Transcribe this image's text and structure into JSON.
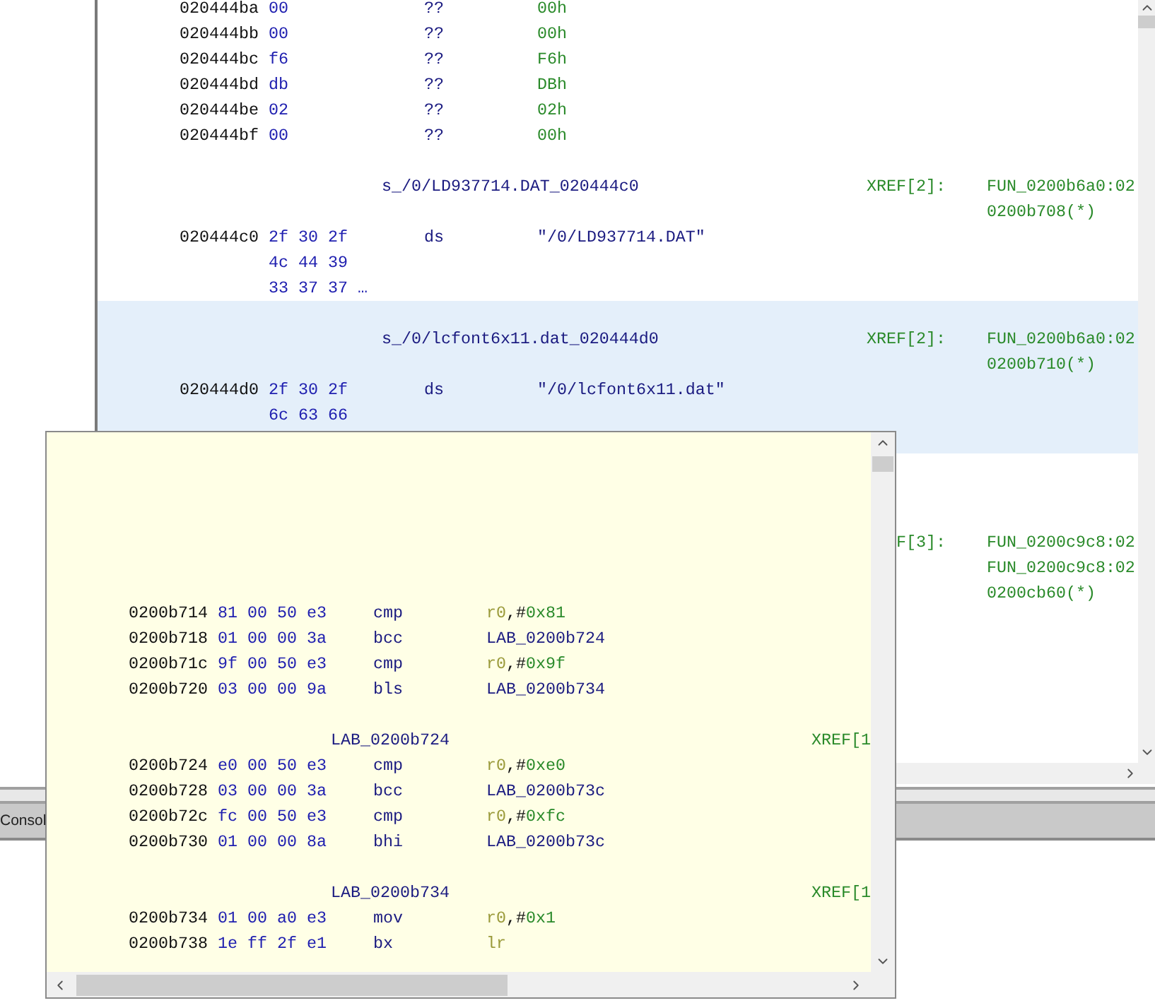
{
  "listing": {
    "rows": [
      {
        "kind": "data",
        "address": "020444ba",
        "bytes": "00",
        "mnemonic": "??",
        "operand": [
          {
            "kind": "scalar",
            "text": "00h"
          }
        ],
        "highlighted": false
      },
      {
        "kind": "data",
        "address": "020444bb",
        "bytes": "00",
        "mnemonic": "??",
        "operand": [
          {
            "kind": "scalar",
            "text": "00h"
          }
        ],
        "highlighted": false
      },
      {
        "kind": "data",
        "address": "020444bc",
        "bytes": "f6",
        "mnemonic": "??",
        "operand": [
          {
            "kind": "scalar",
            "text": "F6h"
          }
        ],
        "highlighted": false
      },
      {
        "kind": "data",
        "address": "020444bd",
        "bytes": "db",
        "mnemonic": "??",
        "operand": [
          {
            "kind": "scalar",
            "text": "DBh"
          }
        ],
        "highlighted": false
      },
      {
        "kind": "data",
        "address": "020444be",
        "bytes": "02",
        "mnemonic": "??",
        "operand": [
          {
            "kind": "scalar",
            "text": "02h"
          }
        ],
        "highlighted": false
      },
      {
        "kind": "data",
        "address": "020444bf",
        "bytes": "00",
        "mnemonic": "??",
        "operand": [
          {
            "kind": "scalar",
            "text": "00h"
          }
        ],
        "highlighted": false
      },
      {
        "kind": "blank",
        "highlighted": false
      },
      {
        "kind": "label",
        "label": "s_/0/LD937714.DAT_020444c0",
        "xref_label": "XREF[2]:",
        "xref": "FUN_0200b6a0:02",
        "highlighted": false
      },
      {
        "kind": "xref",
        "xref": "0200b708(*)",
        "highlighted": false
      },
      {
        "kind": "data",
        "address": "020444c0",
        "bytes": "2f 30 2f",
        "mnemonic": "ds",
        "operand": [
          {
            "kind": "string",
            "text": "\"/0/LD937714.DAT\""
          }
        ],
        "highlighted": false
      },
      {
        "kind": "bytes",
        "bytes": "4c 44 39",
        "highlighted": false
      },
      {
        "kind": "bytes",
        "bytes": "33 37 37 …",
        "highlighted": false
      },
      {
        "kind": "blank",
        "highlighted": true
      },
      {
        "kind": "label",
        "label": "s_/0/lcfont6x11.dat_020444d0",
        "xref_label": "XREF[2]:",
        "xref": "FUN_0200b6a0:02",
        "highlighted": true
      },
      {
        "kind": "xref",
        "xref": "0200b710(*)",
        "highlighted": true
      },
      {
        "kind": "data",
        "address": "020444d0",
        "bytes": "2f 30 2f",
        "mnemonic": "ds",
        "operand": [
          {
            "kind": "string",
            "text": "\"/0/lcfont6x11.dat\""
          }
        ],
        "highlighted": true
      },
      {
        "kind": "bytes",
        "bytes": "6c 63 66",
        "highlighted": true
      },
      {
        "kind": "blank",
        "highlighted": true
      },
      {
        "kind": "blank",
        "highlighted": false
      },
      {
        "kind": "blank",
        "highlighted": false
      },
      {
        "kind": "blank",
        "highlighted": false
      },
      {
        "kind": "label",
        "xref_label": "F[3]:",
        "xref": "FUN_0200c9c8:02",
        "highlighted": false
      },
      {
        "kind": "xref",
        "xref": "FUN_0200c9c8:02",
        "highlighted": false
      },
      {
        "kind": "xref",
        "xref": "0200cb60(*)",
        "highlighted": false
      }
    ]
  },
  "console_tab": {
    "label": "Consol"
  },
  "popup": {
    "rows": [
      {
        "kind": "data",
        "address": "0200b714",
        "bytes": "81 00 50 e3",
        "mnemonic": "cmp",
        "operand": [
          {
            "kind": "register",
            "text": "r0"
          },
          {
            "kind": "punct",
            "text": ",#"
          },
          {
            "kind": "scalar",
            "text": "0x81"
          }
        ]
      },
      {
        "kind": "data",
        "address": "0200b718",
        "bytes": "01 00 00 3a",
        "mnemonic": "bcc",
        "operand": [
          {
            "kind": "label",
            "text": "LAB_0200b724"
          }
        ]
      },
      {
        "kind": "data",
        "address": "0200b71c",
        "bytes": "9f 00 50 e3",
        "mnemonic": "cmp",
        "operand": [
          {
            "kind": "register",
            "text": "r0"
          },
          {
            "kind": "punct",
            "text": ",#"
          },
          {
            "kind": "scalar",
            "text": "0x9f"
          }
        ]
      },
      {
        "kind": "data",
        "address": "0200b720",
        "bytes": "03 00 00 9a",
        "mnemonic": "bls",
        "operand": [
          {
            "kind": "label",
            "text": "LAB_0200b734"
          }
        ]
      },
      {
        "kind": "blank"
      },
      {
        "kind": "label",
        "label": "LAB_0200b724",
        "xref_label": "XREF[1"
      },
      {
        "kind": "data",
        "address": "0200b724",
        "bytes": "e0 00 50 e3",
        "mnemonic": "cmp",
        "operand": [
          {
            "kind": "register",
            "text": "r0"
          },
          {
            "kind": "punct",
            "text": ",#"
          },
          {
            "kind": "scalar",
            "text": "0xe0"
          }
        ]
      },
      {
        "kind": "data",
        "address": "0200b728",
        "bytes": "03 00 00 3a",
        "mnemonic": "bcc",
        "operand": [
          {
            "kind": "label",
            "text": "LAB_0200b73c"
          }
        ]
      },
      {
        "kind": "data",
        "address": "0200b72c",
        "bytes": "fc 00 50 e3",
        "mnemonic": "cmp",
        "operand": [
          {
            "kind": "register",
            "text": "r0"
          },
          {
            "kind": "punct",
            "text": ",#"
          },
          {
            "kind": "scalar",
            "text": "0xfc"
          }
        ]
      },
      {
        "kind": "data",
        "address": "0200b730",
        "bytes": "01 00 00 8a",
        "mnemonic": "bhi",
        "operand": [
          {
            "kind": "label",
            "text": "LAB_0200b73c"
          }
        ]
      },
      {
        "kind": "blank"
      },
      {
        "kind": "label",
        "label": "LAB_0200b734",
        "xref_label": "XREF[1"
      },
      {
        "kind": "data",
        "address": "0200b734",
        "bytes": "01 00 a0 e3",
        "mnemonic": "mov",
        "operand": [
          {
            "kind": "register",
            "text": "r0"
          },
          {
            "kind": "punct",
            "text": ",#"
          },
          {
            "kind": "scalar",
            "text": "0x1"
          }
        ]
      },
      {
        "kind": "data",
        "address": "0200b738",
        "bytes": "1e ff 2f e1",
        "mnemonic": "bx",
        "operand": [
          {
            "kind": "register",
            "text": "lr"
          }
        ]
      }
    ]
  }
}
